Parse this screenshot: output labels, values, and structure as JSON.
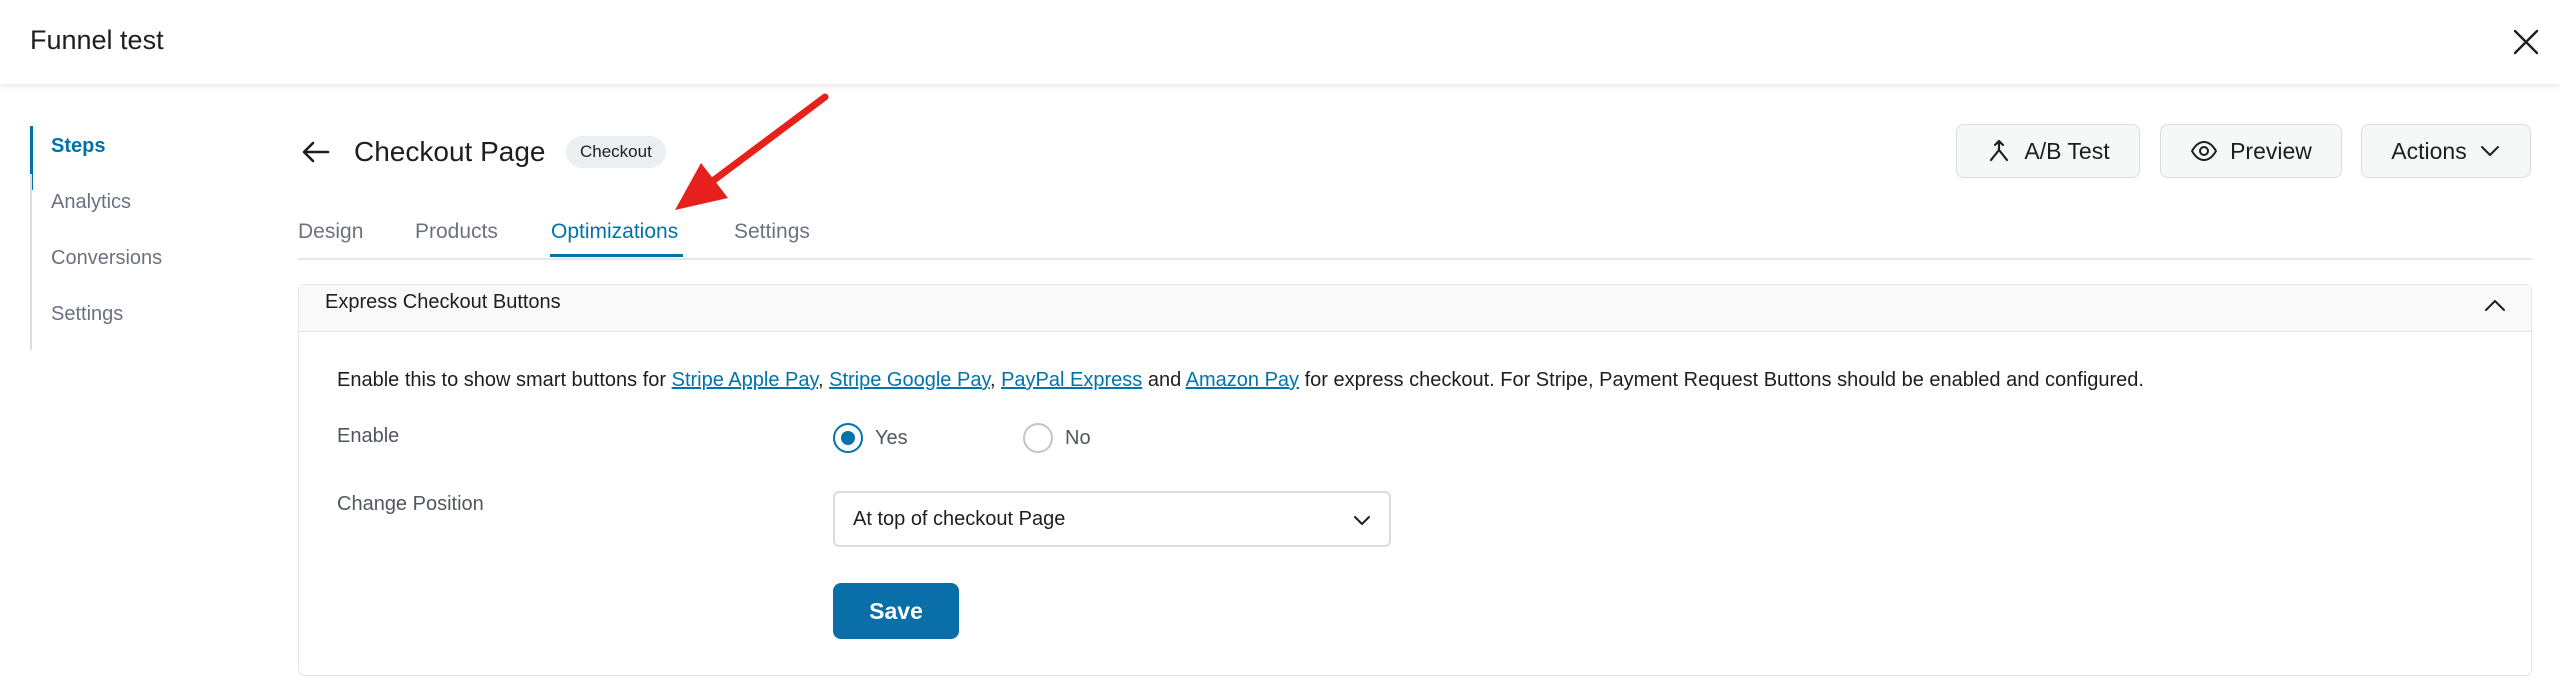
{
  "window": {
    "title": "Funnel test",
    "close_icon": "close-icon"
  },
  "sidebar": {
    "items": [
      {
        "label": "Steps",
        "active": true
      },
      {
        "label": "Analytics",
        "active": false
      },
      {
        "label": "Conversions",
        "active": false
      },
      {
        "label": "Settings",
        "active": false
      }
    ]
  },
  "header": {
    "back_icon": "arrow-left-icon",
    "title": "Checkout Page",
    "badge": "Checkout",
    "buttons": {
      "ab_test": "A/B Test",
      "preview": "Preview",
      "actions": "Actions"
    }
  },
  "tabs": [
    {
      "label": "Design",
      "active": false
    },
    {
      "label": "Products",
      "active": false
    },
    {
      "label": "Optimizations",
      "active": true
    },
    {
      "label": "Settings",
      "active": false
    }
  ],
  "panel": {
    "title": "Express Checkout Buttons",
    "description": {
      "prefix": "Enable this to show smart buttons for ",
      "link1": "Stripe Apple Pay",
      "sep1": ", ",
      "link2": "Stripe Google Pay",
      "sep2": ", ",
      "link3": "PayPal Express",
      "sep3": " and ",
      "link4": "Amazon Pay",
      "suffix": " for express checkout. For Stripe, Payment Request Buttons should be enabled and configured."
    },
    "enable": {
      "label": "Enable",
      "options": [
        {
          "label": "Yes",
          "selected": true
        },
        {
          "label": "No",
          "selected": false
        }
      ]
    },
    "position": {
      "label": "Change Position",
      "selected": "At top of checkout Page"
    },
    "save_label": "Save"
  },
  "colors": {
    "accent": "#0073aa",
    "annotation_arrow": "#e8201d"
  }
}
